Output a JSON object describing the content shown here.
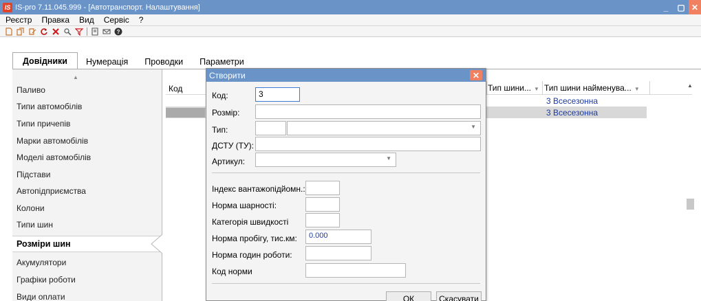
{
  "window": {
    "title": "IS-pro 7.11.045.999 - [Автотранспорт. Налаштування]",
    "app_icon_label": "IS"
  },
  "menu": [
    "Реєстр",
    "Правка",
    "Вид",
    "Сервіс",
    "?"
  ],
  "tabs": [
    {
      "label": "Довідники",
      "active": true
    },
    {
      "label": "Нумерація",
      "active": false
    },
    {
      "label": "Проводки",
      "active": false
    },
    {
      "label": "Параметри",
      "active": false
    }
  ],
  "left_list": {
    "items": [
      "Паливо",
      "Типи автомобілів",
      "Типи причепів",
      "Марки автомобілів",
      "Моделі автомобілів",
      "Підстави",
      "Автопідприємства",
      "Колони",
      "Типи шин",
      "Розміри шин",
      "Акумулятори",
      "Графіки роботи",
      "Види оплати"
    ],
    "active_item": "Розміри шин"
  },
  "grid": {
    "columns": {
      "kod": "Код",
      "tyre_type": "Тип шини...",
      "tyre_type_name": "Тип шини найменува..."
    },
    "rows": [
      {
        "tyre_type": "3",
        "tyre_type_name": "Всесезонна"
      },
      {
        "tyre_type": "3",
        "tyre_type_name": "Всесезонна"
      }
    ]
  },
  "dialog": {
    "title": "Створити",
    "fields": {
      "kod_label": "Код:",
      "kod_value": "3",
      "rozmir_label": "Розмір:",
      "rozmir_value": "",
      "typ_label": "Тип:",
      "typ_value": "",
      "dstu_label": "ДСТУ (ТУ):",
      "dstu_value": "",
      "artykul_label": "Артикул:",
      "artykul_value": "",
      "index_label": "Індекс вантажопідйомн.:",
      "index_value": "",
      "norma_sharnosti_label": "Норма шарності:",
      "norma_sharnosti_value": "",
      "kategoriya_label": "Категорія швидкості",
      "kategoriya_value": "",
      "norma_probigu_label": "Норма пробігу, тис.км:",
      "norma_probigu_value": "0.000",
      "norma_godyn_label": "Норма годин роботи:",
      "norma_godyn_value": "",
      "kod_normy_label": "Код норми",
      "kod_normy_value": ""
    },
    "ok_label": "ОК",
    "cancel_label": "Скасувати"
  },
  "icons": {
    "toolbar": [
      "new-icon",
      "copy-icon",
      "edit-icon",
      "refresh-icon",
      "delete-icon",
      "find-icon",
      "filter-icon",
      "document-icon",
      "mail-icon",
      "help-icon"
    ]
  }
}
